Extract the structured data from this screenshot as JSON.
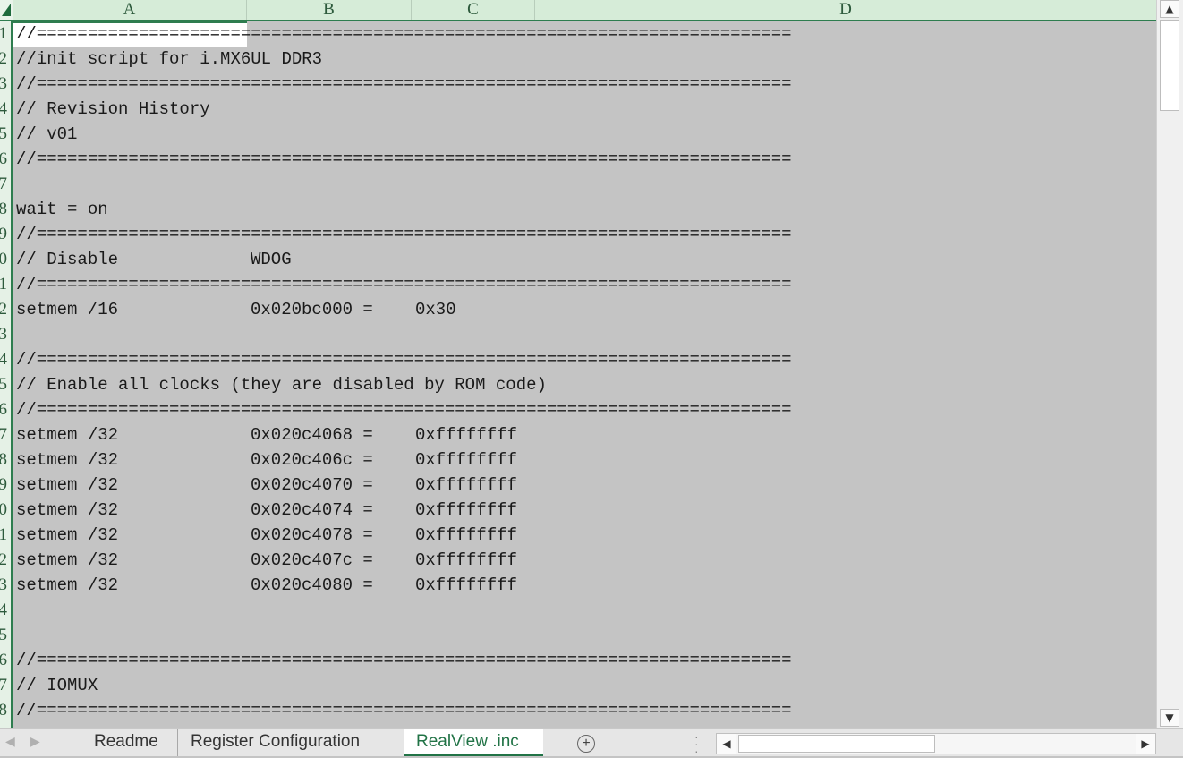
{
  "columns": [
    "A",
    "B",
    "C",
    "D"
  ],
  "row_numbers": [
    "1",
    "2",
    "3",
    "4",
    "5",
    "6",
    "7",
    "8",
    "9",
    "0",
    "1",
    "2",
    "3",
    "4",
    "5",
    "6",
    "7",
    "8",
    "9",
    "0",
    "1",
    "2",
    "3",
    "4",
    "5",
    "6",
    "7",
    "8"
  ],
  "rows": [
    {
      "a": "//=========================================================================="
    },
    {
      "a": "//init script for i.MX6UL DDR3"
    },
    {
      "a": "//=========================================================================="
    },
    {
      "a": "// Revision History"
    },
    {
      "a": "// v01"
    },
    {
      "a": "//=========================================================================="
    },
    {
      "a": ""
    },
    {
      "a": "wait = on"
    },
    {
      "a": "//=========================================================================="
    },
    {
      "a": "// Disable",
      "b": "WDOG"
    },
    {
      "a": "//=========================================================================="
    },
    {
      "a": "setmem /16",
      "b": "0x020bc000 =",
      "c": "0x30"
    },
    {
      "a": ""
    },
    {
      "a": "//=========================================================================="
    },
    {
      "a": "// Enable all clocks (they are disabled by ROM code)"
    },
    {
      "a": "//=========================================================================="
    },
    {
      "a": "setmem /32",
      "b": "0x020c4068 =",
      "c": "0xffffffff"
    },
    {
      "a": "setmem /32",
      "b": "0x020c406c =",
      "c": "0xffffffff"
    },
    {
      "a": "setmem /32",
      "b": "0x020c4070 =",
      "c": "0xffffffff"
    },
    {
      "a": "setmem /32",
      "b": "0x020c4074 =",
      "c": "0xffffffff"
    },
    {
      "a": "setmem /32",
      "b": "0x020c4078 =",
      "c": "0xffffffff"
    },
    {
      "a": "setmem /32",
      "b": "0x020c407c =",
      "c": "0xffffffff"
    },
    {
      "a": "setmem /32",
      "b": "0x020c4080 =",
      "c": "0xffffffff"
    },
    {
      "a": ""
    },
    {
      "a": ""
    },
    {
      "a": "//=========================================================================="
    },
    {
      "a": "// IOMUX"
    },
    {
      "a": "//=========================================================================="
    }
  ],
  "sheet_tabs": [
    "Readme",
    "Register Configuration",
    "RealView .inc"
  ],
  "active_tab_index": 2,
  "icons": {
    "add_sheet": "plus-circle-icon",
    "scroll_up": "triangle-up-icon",
    "scroll_down": "triangle-down-icon",
    "scroll_left": "triangle-left-icon",
    "scroll_right": "triangle-right-icon"
  },
  "colors": {
    "accent": "#217346",
    "sheet_bg": "#c4c4c4",
    "header_bg": "#d6ecd8"
  }
}
